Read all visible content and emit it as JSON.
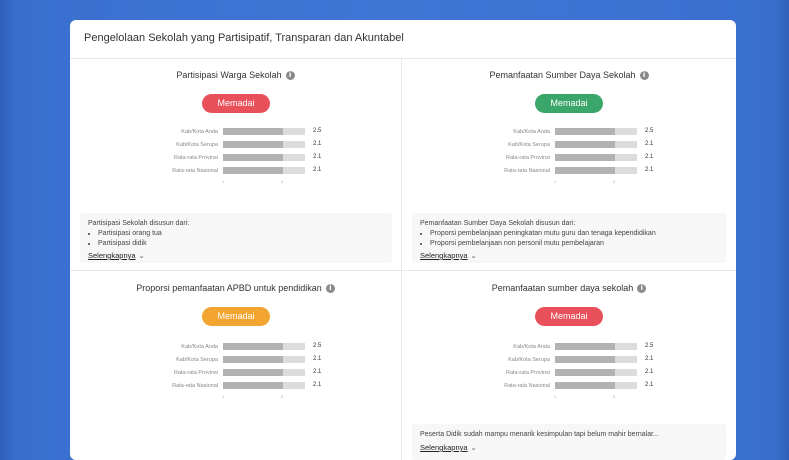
{
  "card": {
    "title": "Pengelolaan Sekolah yang Partisipatif, Transparan dan Akuntabel"
  },
  "rows_labels": [
    "Kab/Kota Anda",
    "Kab/Kota Serupa",
    "Rata-rata Provinsi",
    "Rata-rata Nasional"
  ],
  "axis_ticks": [
    "1",
    "2"
  ],
  "colors": {
    "red": "#e8505b",
    "green": "#3aa66a",
    "orange": "#f2a531"
  },
  "q1": {
    "title": "Partisipasi Warga Sekolah",
    "badge": "Memadai",
    "values": [
      "2.5",
      "2.1",
      "2.1",
      "2.1"
    ],
    "desc_head": "Partisipasi Sekolah disusun dari:",
    "bullets": [
      "Partisipasi orang tua",
      "Partisipasi didik"
    ],
    "more": "Selengkapnya"
  },
  "q2": {
    "title": "Pemanfaatan Sumber Daya Sekolah",
    "badge": "Memadai",
    "values": [
      "2.5",
      "2.1",
      "2.1",
      "2.1"
    ],
    "desc_head": "Pemanfaatan Sumber Daya Sekolah disusun dari:",
    "bullets": [
      "Proporsi pembelanjaan peningkatan mutu guru dan tenaga kependidikan",
      "Proporsi pembelanjaan non personil mutu pembelajaran"
    ],
    "more": "Selengkapnya"
  },
  "q3": {
    "title": "Proporsi pemanfaatan APBD untuk pendidikan",
    "badge": "Memadai",
    "values": [
      "2.5",
      "2.1",
      "2.1",
      "2.1"
    ]
  },
  "q4": {
    "title": "Pemanfaatan sumber daya sekolah",
    "badge": "Memadai",
    "values": [
      "2.5",
      "2.1",
      "2.1",
      "2.1"
    ],
    "desc_head": "Peserta Didik sudah mampu menarik kesimpulan tapi belum mahir bernalar...",
    "more": "Selengkapnya"
  }
}
